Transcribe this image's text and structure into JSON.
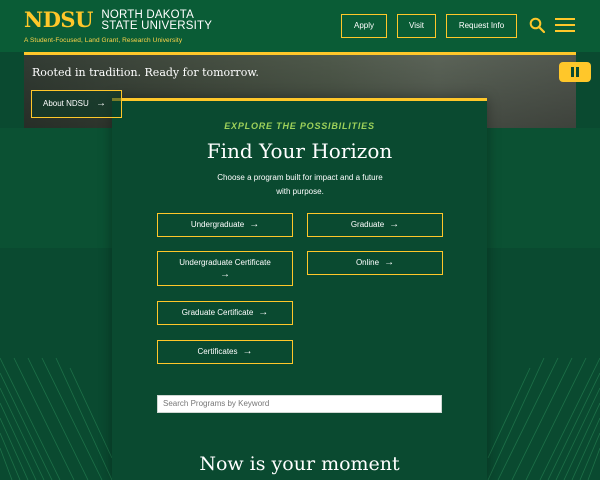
{
  "header": {
    "logo_mark": "NDSU",
    "logo_line1": "NORTH DAKOTA",
    "logo_line2": "STATE UNIVERSITY",
    "tagline": "A Student-Focused, Land Grant, Research University",
    "buttons": {
      "apply": "Apply",
      "visit": "Visit",
      "request": "Request Info"
    },
    "icons": {
      "search": "search-icon",
      "menu": "hamburger-menu-icon"
    }
  },
  "hero": {
    "headline": "Rooted in tradition. Ready for tomorrow.",
    "about_label": "About NDSU",
    "pause_icon": "pause-icon"
  },
  "panel": {
    "eyebrow": "EXPLORE THE POSSIBILITIES",
    "title": "Find Your Horizon",
    "description": "Choose a program built for impact and a future with purpose.",
    "programs": {
      "undergraduate": "Undergraduate",
      "graduate": "Graduate",
      "undergraduate_certificate": "Undergraduate Certificate",
      "online": "Online",
      "graduate_certificate": "Graduate Certificate",
      "certificates": "Certificates"
    },
    "search_placeholder": "Search Programs by Keyword",
    "moment_heading": "Now is your moment"
  },
  "colors": {
    "green": "#0a5c36",
    "dark_green": "#0a4a30",
    "gold": "#ffc72a",
    "lime": "#9ed15a"
  }
}
